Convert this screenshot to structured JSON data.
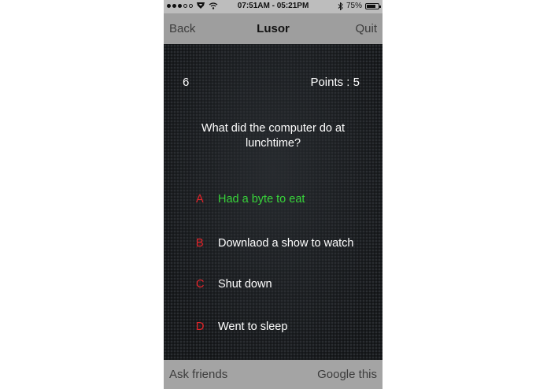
{
  "status_bar": {
    "time": "07:51AM - 05:21PM",
    "battery": "75%",
    "battery_level": 0.75
  },
  "nav": {
    "back_label": "Back",
    "title": "Lusor",
    "quit_label": "Quit"
  },
  "quiz": {
    "question_number": "6",
    "points": "Points : 5",
    "question": "What did the computer do at lunchtime?",
    "answers": [
      {
        "letter": "A",
        "text": "Had a byte to eat",
        "state": "correct"
      },
      {
        "letter": "B",
        "text": "Downlaod a show to watch",
        "state": "normal"
      },
      {
        "letter": "C",
        "text": "Shut down",
        "state": "normal"
      },
      {
        "letter": "D",
        "text": "Went to sleep",
        "state": "normal"
      }
    ]
  },
  "bottom": {
    "ask_friends_label": "Ask friends",
    "google_label": "Google this"
  },
  "colors": {
    "answer_letter": "#e8242a",
    "correct_answer": "#38d53a",
    "nav_bar": "#9e9e9e",
    "bottom_bar": "#a4a4a4",
    "status_bar": "#bdbdbd"
  }
}
